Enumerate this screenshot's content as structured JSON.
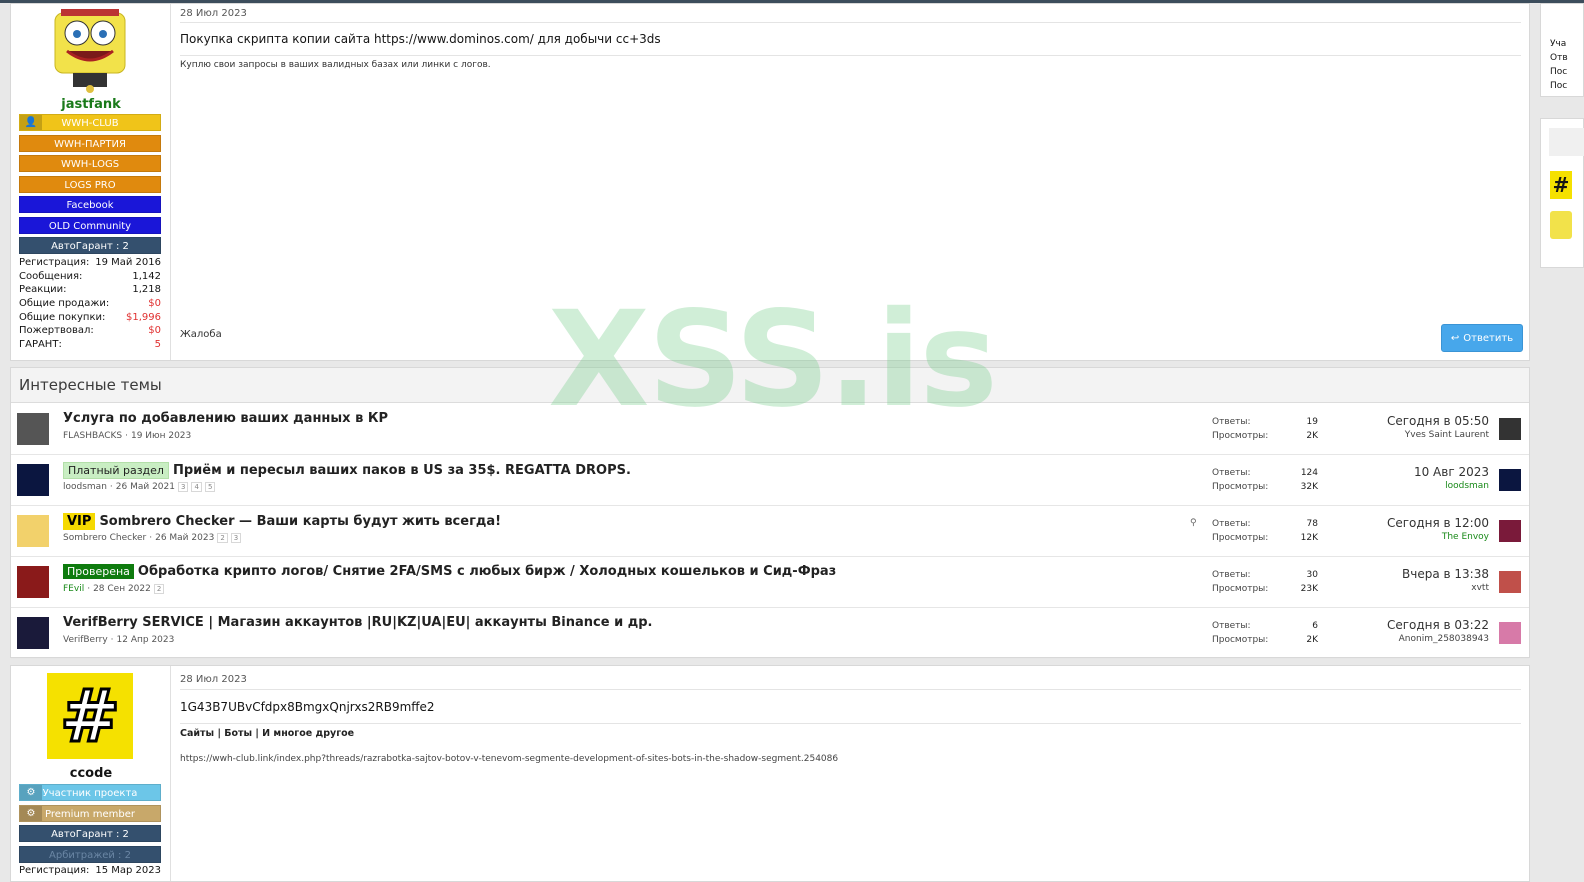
{
  "post1": {
    "date": "28 Июл 2023",
    "title": "Покупка скрипта копии сайта https://www.dominos.com/ для добычи cc+3ds",
    "body": "Куплю свои запросы в ваших валидных базах или линки с логов.",
    "report": "Жалоба",
    "reply": "Ответить",
    "user": {
      "name": "jastfank",
      "name_color": "#1a7a1a",
      "banners": [
        "WWH-CLUB",
        "WWH-ПАРТИЯ",
        "WWH-LOGS",
        "LOGS PRO",
        "Facebook",
        "OLD Community",
        "АвтоГарант : 2"
      ],
      "banner_colors": [
        "#f0c419",
        "#e08a0e",
        "#e08a0e",
        "#e08a0e",
        "#1a16d8",
        "#1a16d8",
        "#34506e"
      ],
      "stats": [
        {
          "label": "Регистрация:",
          "value": "19 Май 2016"
        },
        {
          "label": "Сообщения:",
          "value": "1,142"
        },
        {
          "label": "Реакции:",
          "value": "1,218"
        },
        {
          "label": "Общие продажи:",
          "value": "$0"
        },
        {
          "label": "Общие покупки:",
          "value": "$1,996"
        },
        {
          "label": "Пожертвовал:",
          "value": "$0"
        },
        {
          "label": "ГАРАНТ:",
          "value": "5"
        }
      ]
    }
  },
  "watermark": "XSS.is",
  "block": {
    "title": "Интересные темы",
    "labels": {
      "replies": "Ответы:",
      "views": "Просмотры:"
    },
    "threads": [
      {
        "label": "",
        "title": "Услуга по добавлению ваших данных в КР",
        "author": "FLASHBACKS",
        "date": "19 Июн 2023",
        "pages": [],
        "replies": "19",
        "views": "2K",
        "last_date": "Сегодня в 05:50",
        "last_user": "Yves Saint Laurent",
        "avatar_color": "#555",
        "last_avatar_color": "#333"
      },
      {
        "label": "Платный раздел",
        "title": "Приём и пересыл ваших паков в US за 35$. REGATTA DROPS.",
        "author": "loodsman",
        "date": "26 Май 2021",
        "pages": [
          "3",
          "4",
          "5"
        ],
        "replies": "124",
        "views": "32K",
        "last_date": "10 Авг 2023",
        "last_user": "loodsman",
        "avatar_color": "#0b1640",
        "last_avatar_color": "#0b1640"
      },
      {
        "label": "VIP",
        "title": "Sombrero Checker — Ваши карты будут жить всегда!",
        "author": "Sombrero Checker",
        "date": "26 Май 2023",
        "pages": [
          "2",
          "3"
        ],
        "replies": "78",
        "views": "12K",
        "last_date": "Сегодня в 12:00",
        "last_user": "The Envoy",
        "avatar_color": "#f2d16b",
        "last_avatar_color": "#7a1a3a"
      },
      {
        "label": "Проверена",
        "title": "Обработка крипто логов/ Снятие 2FA/SMS с любых бирж / Холодных кошельков и Сид-Фраз",
        "author": "FEvil",
        "date": "28 Сен 2022",
        "pages": [
          "2"
        ],
        "replies": "30",
        "views": "23K",
        "last_date": "Вчера в 13:38",
        "last_user": "xvtt",
        "avatar_color": "#8a1a1a",
        "last_avatar_color": "#c0504a"
      },
      {
        "label": "",
        "title": "VerifBerry SERVICE | Магазин аккаунтов |RU|KZ|UA|EU| аккаунты Binance и др.",
        "author": "VerifBerry",
        "date": "12 Апр 2023",
        "pages": [],
        "replies": "6",
        "views": "2K",
        "last_date": "Сегодня в 03:22",
        "last_user": "Anonim_258038943",
        "avatar_color": "#1a1a3a",
        "last_avatar_color": "#d77aa8"
      }
    ]
  },
  "post2": {
    "date": "28 Июл 2023",
    "title": "1G43B7UBvCfdpx8BmgxQnjrxs2RB9mffe2",
    "links": "Сайты | Боты | И многое другое",
    "url": "https://wwh-club.link/index.php?threads/razrabotka-sajtov-botov-v-tenevom-segmente-development-of-sites-bots-in-the-shadow-segment.254086",
    "user": {
      "name": "ccode",
      "banners": [
        "Участник проекта",
        "Premium member",
        "АвтоГарант : 2",
        "Арбитражей : 2"
      ],
      "banner_colors": [
        "#6cc6e8",
        "#c8a86a",
        "#34506e",
        "#34506e"
      ],
      "stats": [
        {
          "label": "Регистрация:",
          "value": "15 Мар 2023"
        }
      ]
    }
  },
  "side": {
    "lines": [
      "Уча",
      "Отв",
      "Пос",
      "Пос"
    ]
  }
}
